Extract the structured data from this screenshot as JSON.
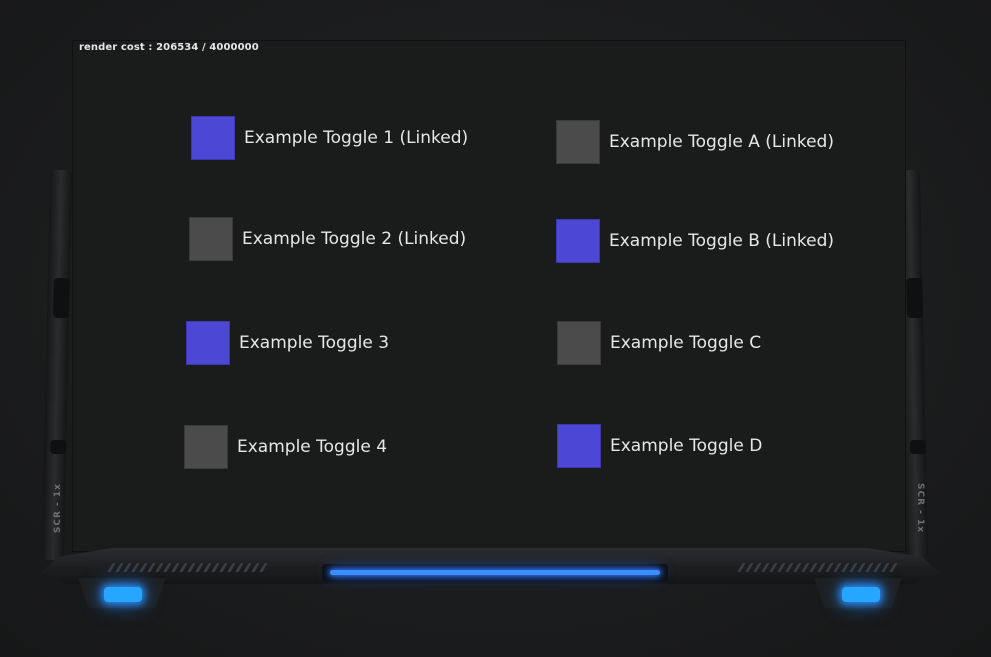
{
  "screen": {
    "render_cost_label": "render cost : 206534 / 4000000"
  },
  "toggles": {
    "t1": {
      "label": "Example Toggle 1 (Linked)",
      "checked": true
    },
    "t2": {
      "label": "Example Toggle 2 (Linked)",
      "checked": false
    },
    "t3": {
      "label": "Example Toggle 3",
      "checked": true
    },
    "t4": {
      "label": "Example Toggle 4",
      "checked": false
    },
    "tA": {
      "label": "Example Toggle A (Linked)",
      "checked": false
    },
    "tB": {
      "label": "Example Toggle B (Linked)",
      "checked": true
    },
    "tC": {
      "label": "Example Toggle C",
      "checked": false
    },
    "tD": {
      "label": "Example Toggle D",
      "checked": true
    }
  },
  "device": {
    "rail_label": "SCR - 1x"
  },
  "colors": {
    "toggle_on": "#4c47d5",
    "toggle_off": "#4b4b4b",
    "accent_light": "#3e8dff",
    "screen_bg": "#1a1b1b"
  },
  "icons": [
    "toggle-checkbox-icon",
    "light-strip-icon"
  ]
}
